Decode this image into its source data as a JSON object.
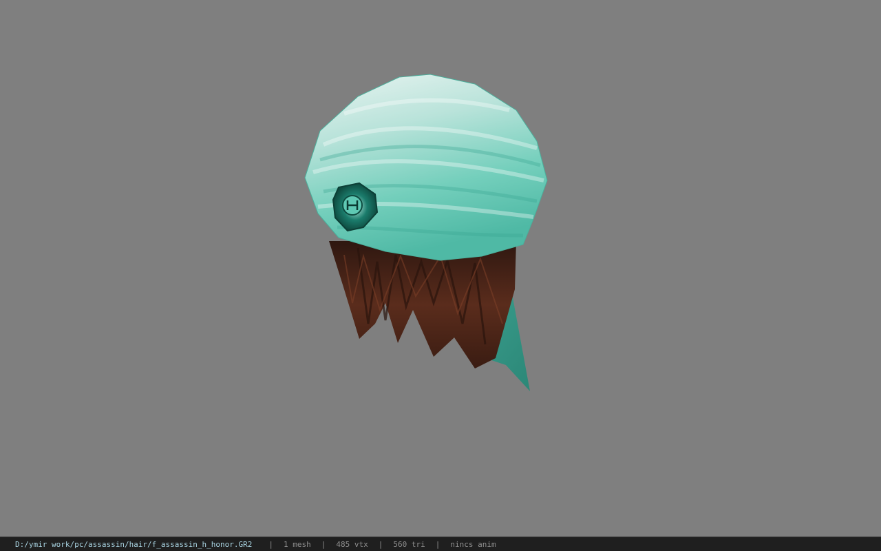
{
  "viewer": {
    "background_color": "#7f7f7f",
    "model": {
      "subject": "female assassin hair with honor bandana",
      "bandana_color": "#58c2ae",
      "hair_color": "#4a2519",
      "emblem_icon": "honor-emblem-icon"
    }
  },
  "status_bar": {
    "file_path": "D:/ymir work/pc/assassin/hair/f_assassin_h_honor.GR2",
    "separator": "|",
    "mesh_count": "1 mesh",
    "vertex_count": "485 vtx",
    "triangle_count": "560 tri",
    "anim_info": "nincs anim"
  }
}
